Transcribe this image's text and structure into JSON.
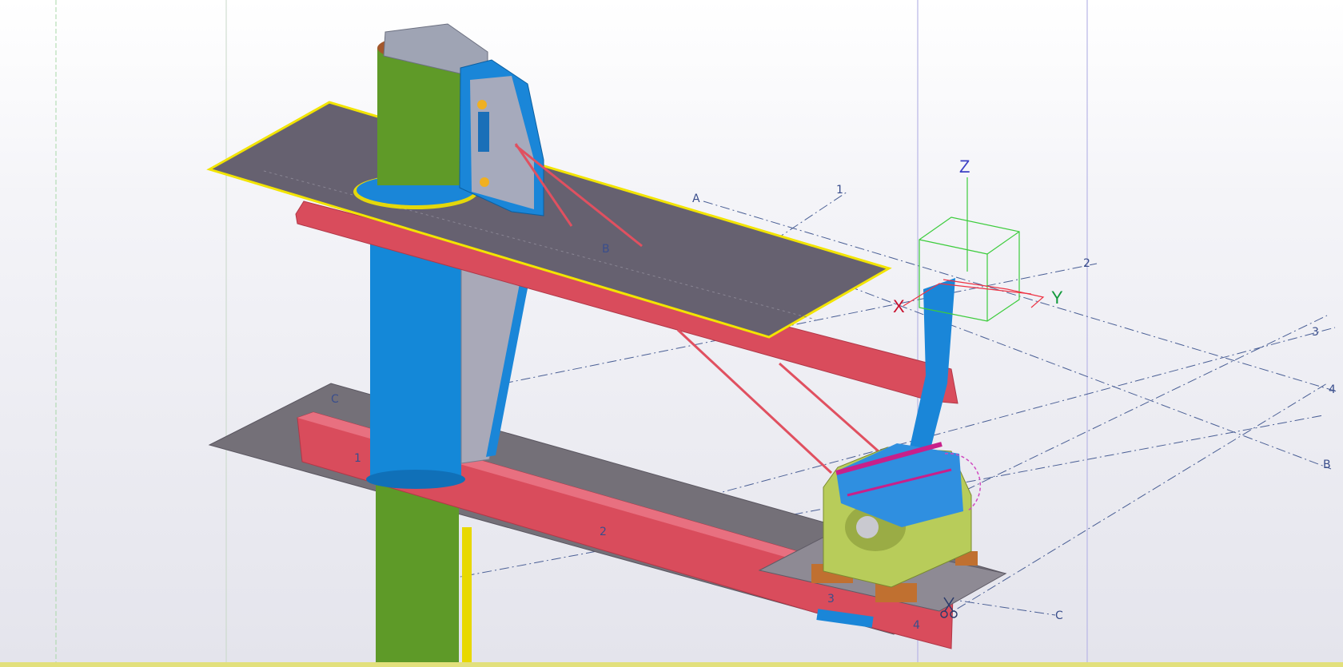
{
  "viewport": {
    "grid_labels": {
      "a_top": "A",
      "b_top": "B",
      "c_left": "C",
      "one_top": "1",
      "one_bottom": "1",
      "two_top": "2",
      "two_bottom": "2",
      "three_right": "3",
      "three_bottom": "3",
      "four_right": "4",
      "four_bottom": "4",
      "b_right": "B",
      "c_right": "C"
    },
    "axes": {
      "x_label": "X",
      "y_label": "Y",
      "z_label": "Z",
      "x_color": "#c8102e",
      "y_color": "#129a3c",
      "z_color": "#3b3fc4"
    },
    "colors": {
      "column_green": "#5f9a28",
      "column_blue": "#1488d8",
      "beam_red": "#d94c5c",
      "plate_gray": "#6e6a72",
      "selection_yellow": "#f2e400",
      "bracket_blue": "#1a86d8",
      "motor_green": "#b8cc5a",
      "motor_coil": "#2f8fe0",
      "motor_feet": "#c07030"
    }
  }
}
